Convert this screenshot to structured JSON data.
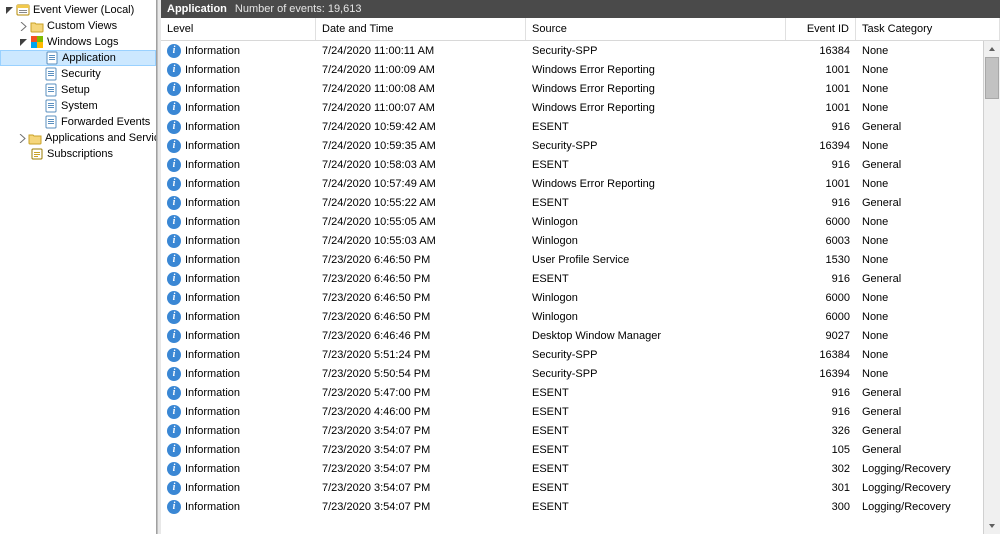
{
  "tree": {
    "root_label": "Event Viewer (Local)",
    "items": [
      {
        "indent": 0,
        "expand": "open",
        "icon": "eventviewer",
        "label": "Event Viewer (Local)",
        "selected": false,
        "interact": true
      },
      {
        "indent": 1,
        "expand": "closed",
        "icon": "folder",
        "label": "Custom Views",
        "selected": false,
        "interact": true
      },
      {
        "indent": 1,
        "expand": "open",
        "icon": "winlogs",
        "label": "Windows Logs",
        "selected": false,
        "interact": true
      },
      {
        "indent": 2,
        "expand": "none",
        "icon": "log",
        "label": "Application",
        "selected": true,
        "interact": true
      },
      {
        "indent": 2,
        "expand": "none",
        "icon": "log",
        "label": "Security",
        "selected": false,
        "interact": true
      },
      {
        "indent": 2,
        "expand": "none",
        "icon": "log",
        "label": "Setup",
        "selected": false,
        "interact": true
      },
      {
        "indent": 2,
        "expand": "none",
        "icon": "log",
        "label": "System",
        "selected": false,
        "interact": true
      },
      {
        "indent": 2,
        "expand": "none",
        "icon": "log",
        "label": "Forwarded Events",
        "selected": false,
        "interact": true
      },
      {
        "indent": 1,
        "expand": "closed",
        "icon": "folder",
        "label": "Applications and Services Lo",
        "selected": false,
        "interact": true
      },
      {
        "indent": 1,
        "expand": "none",
        "icon": "subs",
        "label": "Subscriptions",
        "selected": false,
        "interact": true
      }
    ]
  },
  "header": {
    "title": "Application",
    "count_label": "Number of events: 19,613"
  },
  "columns": {
    "level": "Level",
    "date": "Date and Time",
    "source": "Source",
    "eventid": "Event ID",
    "category": "Task Category"
  },
  "rows": [
    {
      "level": "Information",
      "date": "7/24/2020 11:00:11 AM",
      "source": "Security-SPP",
      "id": "16384",
      "cat": "None"
    },
    {
      "level": "Information",
      "date": "7/24/2020 11:00:09 AM",
      "source": "Windows Error Reporting",
      "id": "1001",
      "cat": "None"
    },
    {
      "level": "Information",
      "date": "7/24/2020 11:00:08 AM",
      "source": "Windows Error Reporting",
      "id": "1001",
      "cat": "None"
    },
    {
      "level": "Information",
      "date": "7/24/2020 11:00:07 AM",
      "source": "Windows Error Reporting",
      "id": "1001",
      "cat": "None"
    },
    {
      "level": "Information",
      "date": "7/24/2020 10:59:42 AM",
      "source": "ESENT",
      "id": "916",
      "cat": "General"
    },
    {
      "level": "Information",
      "date": "7/24/2020 10:59:35 AM",
      "source": "Security-SPP",
      "id": "16394",
      "cat": "None"
    },
    {
      "level": "Information",
      "date": "7/24/2020 10:58:03 AM",
      "source": "ESENT",
      "id": "916",
      "cat": "General"
    },
    {
      "level": "Information",
      "date": "7/24/2020 10:57:49 AM",
      "source": "Windows Error Reporting",
      "id": "1001",
      "cat": "None"
    },
    {
      "level": "Information",
      "date": "7/24/2020 10:55:22 AM",
      "source": "ESENT",
      "id": "916",
      "cat": "General"
    },
    {
      "level": "Information",
      "date": "7/24/2020 10:55:05 AM",
      "source": "Winlogon",
      "id": "6000",
      "cat": "None"
    },
    {
      "level": "Information",
      "date": "7/24/2020 10:55:03 AM",
      "source": "Winlogon",
      "id": "6003",
      "cat": "None"
    },
    {
      "level": "Information",
      "date": "7/23/2020 6:46:50 PM",
      "source": "User Profile Service",
      "id": "1530",
      "cat": "None"
    },
    {
      "level": "Information",
      "date": "7/23/2020 6:46:50 PM",
      "source": "ESENT",
      "id": "916",
      "cat": "General"
    },
    {
      "level": "Information",
      "date": "7/23/2020 6:46:50 PM",
      "source": "Winlogon",
      "id": "6000",
      "cat": "None"
    },
    {
      "level": "Information",
      "date": "7/23/2020 6:46:50 PM",
      "source": "Winlogon",
      "id": "6000",
      "cat": "None"
    },
    {
      "level": "Information",
      "date": "7/23/2020 6:46:46 PM",
      "source": "Desktop Window Manager",
      "id": "9027",
      "cat": "None"
    },
    {
      "level": "Information",
      "date": "7/23/2020 5:51:24 PM",
      "source": "Security-SPP",
      "id": "16384",
      "cat": "None"
    },
    {
      "level": "Information",
      "date": "7/23/2020 5:50:54 PM",
      "source": "Security-SPP",
      "id": "16394",
      "cat": "None"
    },
    {
      "level": "Information",
      "date": "7/23/2020 5:47:00 PM",
      "source": "ESENT",
      "id": "916",
      "cat": "General"
    },
    {
      "level": "Information",
      "date": "7/23/2020 4:46:00 PM",
      "source": "ESENT",
      "id": "916",
      "cat": "General"
    },
    {
      "level": "Information",
      "date": "7/23/2020 3:54:07 PM",
      "source": "ESENT",
      "id": "326",
      "cat": "General"
    },
    {
      "level": "Information",
      "date": "7/23/2020 3:54:07 PM",
      "source": "ESENT",
      "id": "105",
      "cat": "General"
    },
    {
      "level": "Information",
      "date": "7/23/2020 3:54:07 PM",
      "source": "ESENT",
      "id": "302",
      "cat": "Logging/Recovery"
    },
    {
      "level": "Information",
      "date": "7/23/2020 3:54:07 PM",
      "source": "ESENT",
      "id": "301",
      "cat": "Logging/Recovery"
    },
    {
      "level": "Information",
      "date": "7/23/2020 3:54:07 PM",
      "source": "ESENT",
      "id": "300",
      "cat": "Logging/Recovery"
    }
  ]
}
